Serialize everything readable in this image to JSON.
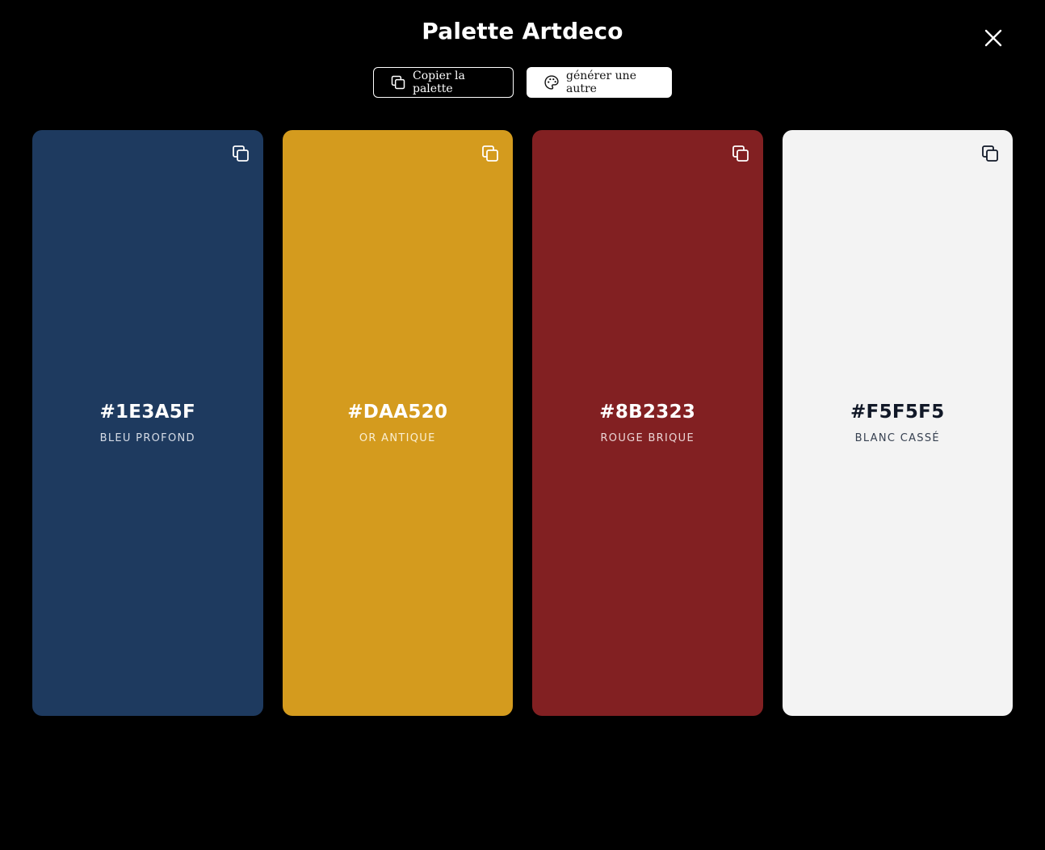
{
  "header": {
    "title": "Palette Artdeco",
    "close_icon": "close-icon"
  },
  "actions": {
    "copy_palette_label": "Copier la palette",
    "copy_palette_icon": "copy-icon",
    "generate_label": "générer une autre",
    "generate_icon": "palette-icon"
  },
  "swatches": [
    {
      "hex": "#1E3A5F",
      "name": "BLEU PROFOND",
      "color": "#1E3A5F",
      "text_color": "#FFFFFF",
      "sub_color": "#D6DCE6",
      "icon": "copy-icon"
    },
    {
      "hex": "#DAA520",
      "name": "OR ANTIQUE",
      "color": "#D49B1E",
      "text_color": "#FFFFFF",
      "sub_color": "#FBEFD2",
      "icon": "copy-icon"
    },
    {
      "hex": "#8B2323",
      "name": "ROUGE BRIQUE",
      "color": "#822022",
      "text_color": "#FFFFFF",
      "sub_color": "#EBD5D5",
      "icon": "copy-icon"
    },
    {
      "hex": "#F5F5F5",
      "name": "BLANC CASSÉ",
      "color": "#F3F3F3",
      "text_color": "#111827",
      "sub_color": "#374151",
      "icon": "copy-icon"
    }
  ]
}
